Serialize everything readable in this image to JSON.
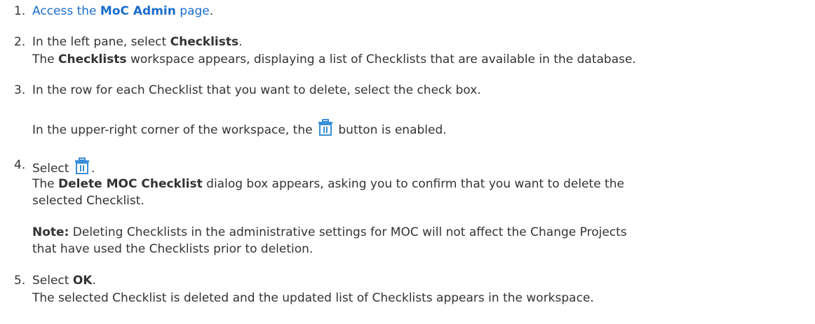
{
  "steps": [
    {
      "num": "1.",
      "link_pre": "Access the ",
      "link_bold": "MoC Admin",
      "link_post": " page",
      "tail": "."
    },
    {
      "num": "2.",
      "pre": "In the left pane, select ",
      "bold": "Checklists",
      "post": ".",
      "result_bold": "Checklists",
      "result_post": " workspace appears, displaying a list of Checklists that are available in the database.",
      "result_pre": "The "
    },
    {
      "num": "3.",
      "text": "In the row for each Checklist that you want to delete, select the check box.",
      "result_pre": "In the upper-right corner of the workspace, the ",
      "result_post": " button is enabled."
    },
    {
      "num": "4.",
      "pre": "Select ",
      "post": ".",
      "result_pre": "The ",
      "result_bold": "Delete MOC Checklist",
      "result_post": " dialog box appears, asking you to confirm that you want to delete the",
      "result_line2": "selected Checklist.",
      "note_label": "Note:",
      "note_text": " Deleting Checklists in the administrative settings for MOC will not affect the Change Projects",
      "note_line2": "that have used the Checklists prior to deletion."
    },
    {
      "num": "5.",
      "pre": "Select ",
      "bold": "OK",
      "post": ".",
      "result": "The selected Checklist is deleted and the updated list of Checklists appears in the workspace."
    }
  ],
  "icons": {
    "trash": "trash-icon",
    "trash_color": "#3a8fd9"
  }
}
